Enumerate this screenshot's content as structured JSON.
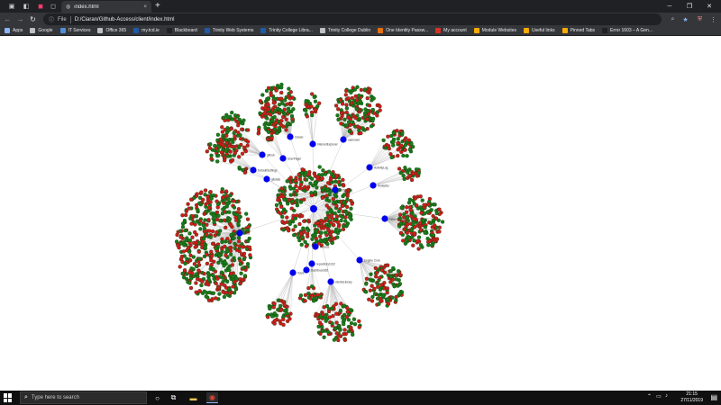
{
  "tabstrip": {
    "mini_tabs": [
      "▣",
      "◧",
      "◼",
      "◻"
    ],
    "active_tab_title": "index.html",
    "close_glyph": "×",
    "new_tab_glyph": "+",
    "window_controls": [
      "─",
      "❐",
      "✕"
    ]
  },
  "toolbar": {
    "back": "←",
    "forward": "→",
    "reload": "↻",
    "info_glyph": "ⓘ",
    "scheme": "File",
    "url": "D:/Ciaran/Github-Access/client/index.html",
    "right_icons": [
      "⌕",
      "★",
      "⛨",
      "⋮"
    ]
  },
  "bookmarks": [
    {
      "label": "Apps",
      "color": "#8ab4f8"
    },
    {
      "label": "Google",
      "color": "#bdc1c6"
    },
    {
      "label": "IT Services",
      "color": "#4f8fd9"
    },
    {
      "label": "Office 365",
      "color": "#bdc1c6"
    },
    {
      "label": "my.tcd.ie",
      "color": "#1f5aa6"
    },
    {
      "label": "Blackboard",
      "color": "#222222"
    },
    {
      "label": "Trinity Web Systems",
      "color": "#1f5aa6"
    },
    {
      "label": "Trinity College Libra...",
      "color": "#1f5aa6"
    },
    {
      "label": "Trinity College Dublin",
      "color": "#bdc1c6"
    },
    {
      "label": "One Identity Passw...",
      "color": "#e8710a"
    },
    {
      "label": "My account",
      "color": "#d93025"
    },
    {
      "label": "Module Websites",
      "color": "#f9ab00"
    },
    {
      "label": "Useful links",
      "color": "#f9ab00"
    },
    {
      "label": "Pinned Tabs",
      "color": "#f9ab00"
    },
    {
      "label": "Error 1603 – A Gen...",
      "color": "#202124"
    }
  ],
  "graph": {
    "hub_label": "",
    "node_color": "#0000ee",
    "leaf_colors": [
      "#d11c1c",
      "#1a7a1a"
    ],
    "link_color": "#b9b9b9",
    "nodes": [
      {
        "label": "Ciaran"
      },
      {
        "label": "InternetExplorer"
      },
      {
        "label": "openuser"
      },
      {
        "label": "github"
      },
      {
        "label": "UserPager"
      },
      {
        "label": "DefaultSettings"
      },
      {
        "label": "gitstats"
      },
      {
        "label": "ActivityLog"
      },
      {
        "label": "Analytics"
      },
      {
        "label": "index"
      },
      {
        "label": "data"
      },
      {
        "label": "TCD_Proj"
      },
      {
        "label": "Access"
      },
      {
        "label": "Engine Core"
      },
      {
        "label": "repository1132"
      },
      {
        "label": "Tools"
      },
      {
        "label": "clientsLibrary"
      },
      {
        "label": "Dashboard16"
      }
    ]
  },
  "taskbar": {
    "search_placeholder": "Type here to search",
    "time": "21:15",
    "date": "27/11/2019",
    "tray_glyphs": [
      "⌃",
      "▭",
      "♪",
      "ENG"
    ],
    "notif_glyph": "▤"
  }
}
